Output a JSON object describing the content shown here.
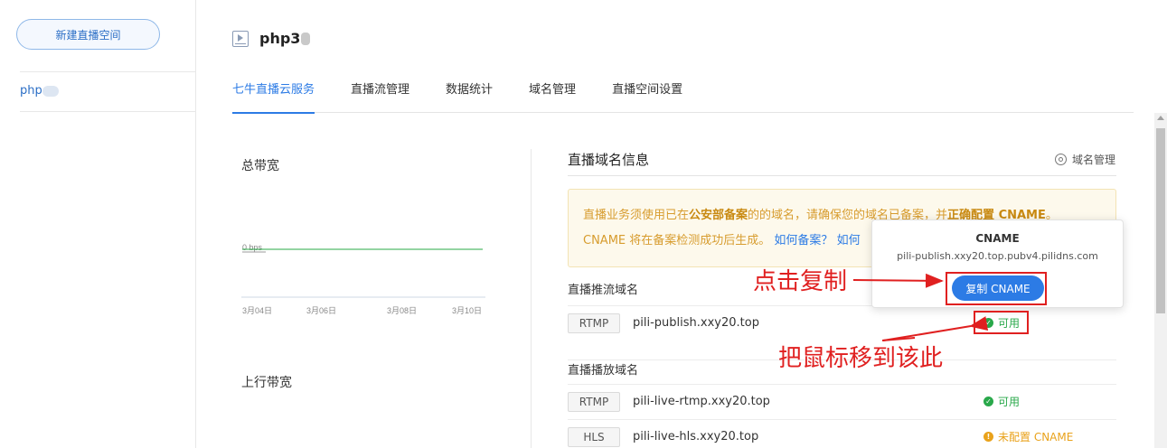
{
  "sidebar": {
    "new_space_button": "新建直播空间",
    "items": [
      {
        "label": "php"
      }
    ]
  },
  "header": {
    "title": "php3"
  },
  "tabs": [
    {
      "label": "七牛直播云服务",
      "active": true
    },
    {
      "label": "直播流管理"
    },
    {
      "label": "数据统计"
    },
    {
      "label": "域名管理"
    },
    {
      "label": "直播空间设置"
    }
  ],
  "bandwidth": {
    "total_title": "总带宽",
    "upstream_title": "上行带宽",
    "zero_label": "0 bps"
  },
  "chart_data": {
    "type": "line",
    "title": "总带宽",
    "categories": [
      "3月04日",
      "3月06日",
      "3月08日",
      "3月10日"
    ],
    "series": [
      {
        "values": [
          0,
          0,
          0,
          0
        ]
      }
    ],
    "ytick_labels": [
      "0 bps"
    ],
    "grid": false
  },
  "domain_panel": {
    "title": "直播域名信息",
    "manage_link": "域名管理",
    "notice": {
      "p1": "直播业务须使用已在",
      "b1": "公安部备案",
      "p2": "的的域名，请确保您的域名已备案，并",
      "b2": "正确配置 CNAME",
      "p3": "。",
      "p4": "CNAME 将在备案检测成功后生成。",
      "link1": "如何备案？",
      "link2": "如何"
    },
    "push_label": "直播推流域名",
    "play_label": "直播播放域名",
    "push_rows": [
      {
        "protocol": "RTMP",
        "domain": "pili-publish.xxy20.top",
        "status": "可用",
        "state": "ok"
      }
    ],
    "play_rows": [
      {
        "protocol": "RTMP",
        "domain": "pili-live-rtmp.xxy20.top",
        "status": "可用",
        "state": "ok"
      },
      {
        "protocol": "HLS",
        "domain": "pili-live-hls.xxy20.top",
        "status": "未配置 CNAME",
        "state": "warn"
      }
    ]
  },
  "popover": {
    "title": "CNAME",
    "value": "pili-publish.xxy20.top.pubv4.pilidns.com",
    "copy_button": "复制 CNAME"
  },
  "annotations": {
    "click_copy": "点击复制",
    "hover_here": "把鼠标移到该此"
  },
  "colors": {
    "accent": "#2c7be5",
    "ok": "#29a84a",
    "warn": "#e9a21b",
    "annotation": "#e02020"
  }
}
